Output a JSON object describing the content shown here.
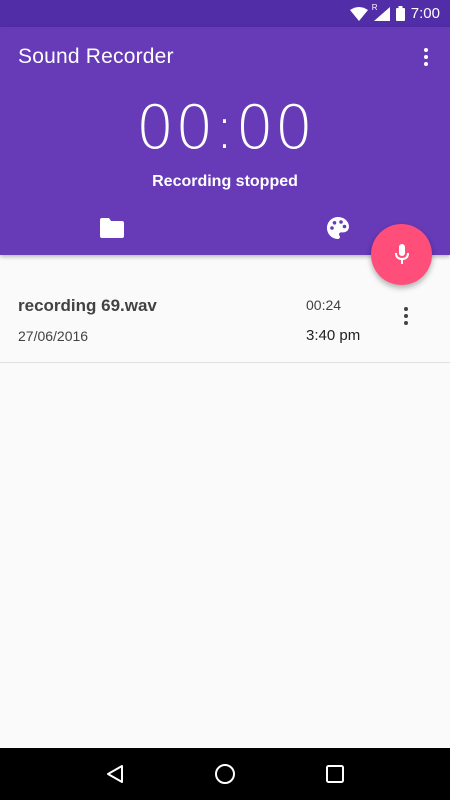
{
  "status_bar": {
    "time": "7:00",
    "roaming_badge": "R",
    "icons": [
      "wifi-icon",
      "signal-icon",
      "battery-icon"
    ]
  },
  "app": {
    "title": "Sound Recorder",
    "timer": "00:00",
    "recording_status": "Recording stopped"
  },
  "tabs": [
    {
      "icon": "folder-icon"
    },
    {
      "icon": "palette-icon"
    }
  ],
  "fab": {
    "icon": "microphone-icon",
    "color": "#ff4e7a"
  },
  "recordings": [
    {
      "name": "recording 69.wav",
      "date": "27/06/2016",
      "duration": "00:24",
      "time": "3:40 pm"
    }
  ],
  "colors": {
    "primary": "#673ab7",
    "primary_dark": "#512da8",
    "accent": "#ff4e7a"
  },
  "nav_bar": {
    "buttons": [
      "back-icon",
      "home-icon",
      "recents-icon"
    ]
  }
}
